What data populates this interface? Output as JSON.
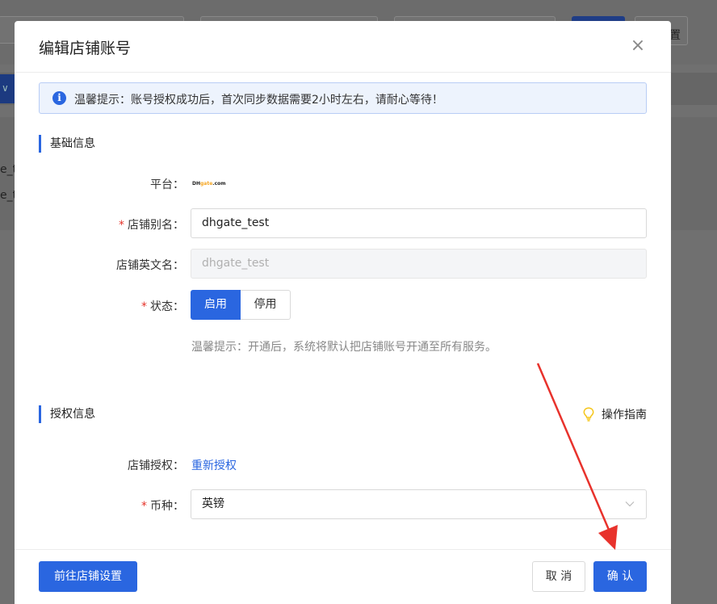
{
  "background": {
    "partial_button_text": "置",
    "row1_text": "e_t",
    "row2_text": "e_t",
    "collapse_glyph": "∨"
  },
  "modal": {
    "title": "编辑店铺账号",
    "close_glyph": "×",
    "alert": {
      "icon_glyph": "i",
      "text": "温馨提示：账号授权成功后，首次同步数据需要2小时左右，请耐心等待！"
    },
    "basic_section": {
      "title": "基础信息",
      "platform_label": "平台：",
      "platform_logo_text": "DH",
      "platform_logo_accent": "gate",
      "platform_logo_suffix": ".com",
      "required_mark": "*",
      "alias_label": "店铺别名：",
      "alias_value": "dhgate_test",
      "english_name_label": "店铺英文名：",
      "english_name_value": "dhgate_test",
      "status_label": "状态：",
      "status_options": [
        "启用",
        "停用"
      ],
      "status_selected": "启用",
      "hint": "温馨提示：开通后，系统将默认把店铺账号开通至所有服务。"
    },
    "auth_section": {
      "title": "授权信息",
      "guide_label": "操作指南",
      "authorization_label": "店铺授权：",
      "reauthorize_link": "重新授权",
      "currency_label": "币种：",
      "currency_value": "英镑"
    },
    "footer": {
      "store_settings_button": "前往店铺设置",
      "cancel_button": "取 消",
      "confirm_button": "确 认"
    }
  },
  "colors": {
    "primary": "#2a66e0",
    "required": "#e5332a",
    "annotation_arrow": "#e8322c",
    "guide_bulb": "#f5c518"
  }
}
